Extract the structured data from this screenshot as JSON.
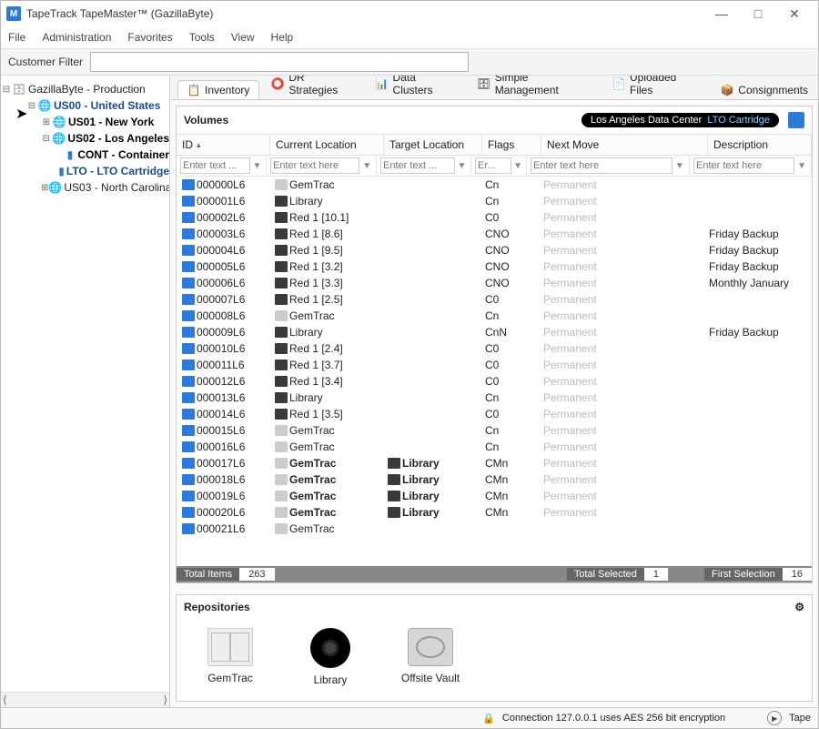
{
  "window": {
    "title": "TapeTrack TapeMaster™ (GazillaByte)",
    "app_icon_letter": "M"
  },
  "menu": {
    "items": [
      "File",
      "Administration",
      "Favorites",
      "Tools",
      "View",
      "Help"
    ]
  },
  "customer_filter": {
    "label": "Customer Filter",
    "value": ""
  },
  "tree": {
    "root": {
      "label": "GazillaByte - Production"
    },
    "nodes": [
      {
        "label": "US00 - United States",
        "depth": 1,
        "style": "bold-blue",
        "expander": "⊟",
        "icon": "globe"
      },
      {
        "label": "US01 - New York",
        "depth": 2,
        "style": "bold-black",
        "expander": "⊞",
        "icon": "globe"
      },
      {
        "label": "US02 - Los Angeles",
        "depth": 2,
        "style": "bold-black",
        "expander": "⊟",
        "icon": "globe"
      },
      {
        "label": "CONT - Container",
        "depth": 3,
        "style": "bold-black",
        "expander": "",
        "icon": "blue-card"
      },
      {
        "label": "LTO - LTO Cartridge",
        "depth": 3,
        "style": "bold-blue",
        "expander": "",
        "icon": "blue-card"
      },
      {
        "label": "US03 - North Carolina",
        "depth": 2,
        "style": "",
        "expander": "⊞",
        "icon": "globe"
      }
    ]
  },
  "tabs": [
    {
      "label": "Inventory",
      "icon": "📋",
      "active": true
    },
    {
      "label": "DR Strategies",
      "icon": "⭕",
      "active": false
    },
    {
      "label": "Data Clusters",
      "icon": "📊",
      "active": false
    },
    {
      "label": "Simple Management",
      "icon": "🗄",
      "active": false
    },
    {
      "label": "Uploaded Files",
      "icon": "📄",
      "active": false
    },
    {
      "label": "Consignments",
      "icon": "📦",
      "active": false
    }
  ],
  "panel": {
    "title": "Volumes",
    "badge_location": "Los Angeles Data Center",
    "badge_media": "LTO Cartridge"
  },
  "columns": {
    "id": "ID",
    "cur": "Current Location",
    "tgt": "Target Location",
    "flags": "Flags",
    "next": "Next Move",
    "desc": "Description"
  },
  "filters": {
    "id": "Enter text ...",
    "cur": "Enter text here",
    "tgt": "Enter text ...",
    "flags": "Er...",
    "next": "Enter text here",
    "desc": "Enter text here"
  },
  "rows": [
    {
      "id": "000000L6",
      "cur_icon": "grey",
      "cur": "GemTrac",
      "tgt_icon": "",
      "tgt": "",
      "flags": "Cn",
      "next": "Permanent",
      "desc": ""
    },
    {
      "id": "000001L6",
      "cur_icon": "dark",
      "cur": "Library",
      "tgt_icon": "",
      "tgt": "",
      "flags": "Cn",
      "next": "Permanent",
      "desc": ""
    },
    {
      "id": "000002L6",
      "cur_icon": "dark",
      "cur": "Red 1 [10.1]",
      "tgt_icon": "",
      "tgt": "",
      "flags": "C0",
      "next": "Permanent",
      "desc": ""
    },
    {
      "id": "000003L6",
      "cur_icon": "dark",
      "cur": "Red 1 [8.6]",
      "tgt_icon": "",
      "tgt": "",
      "flags": "CNO",
      "next": "Permanent",
      "desc": "Friday Backup"
    },
    {
      "id": "000004L6",
      "cur_icon": "dark",
      "cur": "Red 1 [9.5]",
      "tgt_icon": "",
      "tgt": "",
      "flags": "CNO",
      "next": "Permanent",
      "desc": "Friday Backup"
    },
    {
      "id": "000005L6",
      "cur_icon": "dark",
      "cur": "Red 1 [3.2]",
      "tgt_icon": "",
      "tgt": "",
      "flags": "CNO",
      "next": "Permanent",
      "desc": "Friday Backup"
    },
    {
      "id": "000006L6",
      "cur_icon": "dark",
      "cur": "Red 1 [3.3]",
      "tgt_icon": "",
      "tgt": "",
      "flags": "CNO",
      "next": "Permanent",
      "desc": "Monthly January"
    },
    {
      "id": "000007L6",
      "cur_icon": "dark",
      "cur": "Red 1 [2.5]",
      "tgt_icon": "",
      "tgt": "",
      "flags": "C0",
      "next": "Permanent",
      "desc": ""
    },
    {
      "id": "000008L6",
      "cur_icon": "grey",
      "cur": "GemTrac",
      "tgt_icon": "",
      "tgt": "",
      "flags": "Cn",
      "next": "Permanent",
      "desc": ""
    },
    {
      "id": "000009L6",
      "cur_icon": "dark",
      "cur": "Library",
      "tgt_icon": "",
      "tgt": "",
      "flags": "CnN",
      "next": "Permanent",
      "desc": "Friday Backup"
    },
    {
      "id": "000010L6",
      "cur_icon": "dark",
      "cur": "Red 1 [2.4]",
      "tgt_icon": "",
      "tgt": "",
      "flags": "C0",
      "next": "Permanent",
      "desc": ""
    },
    {
      "id": "000011L6",
      "cur_icon": "dark",
      "cur": "Red 1 [3.7]",
      "tgt_icon": "",
      "tgt": "",
      "flags": "C0",
      "next": "Permanent",
      "desc": ""
    },
    {
      "id": "000012L6",
      "cur_icon": "dark",
      "cur": "Red 1 [3.4]",
      "tgt_icon": "",
      "tgt": "",
      "flags": "C0",
      "next": "Permanent",
      "desc": ""
    },
    {
      "id": "000013L6",
      "cur_icon": "dark",
      "cur": "Library",
      "tgt_icon": "",
      "tgt": "",
      "flags": "Cn",
      "next": "Permanent",
      "desc": ""
    },
    {
      "id": "000014L6",
      "cur_icon": "dark",
      "cur": "Red 1 [3.5]",
      "tgt_icon": "",
      "tgt": "",
      "flags": "C0",
      "next": "Permanent",
      "desc": ""
    },
    {
      "id": "000015L6",
      "cur_icon": "grey",
      "cur": "GemTrac",
      "tgt_icon": "",
      "tgt": "",
      "flags": "Cn",
      "next": "Permanent",
      "desc": ""
    },
    {
      "id": "000016L6",
      "cur_icon": "grey",
      "cur": "GemTrac",
      "tgt_icon": "",
      "tgt": "",
      "flags": "Cn",
      "next": "Permanent",
      "desc": ""
    },
    {
      "id": "000017L6",
      "cur_icon": "grey",
      "cur": "GemTrac",
      "cur_bold": true,
      "tgt_icon": "dark",
      "tgt": "Library",
      "tgt_bold": true,
      "flags": "CMn",
      "next": "Permanent",
      "desc": ""
    },
    {
      "id": "000018L6",
      "cur_icon": "grey",
      "cur": "GemTrac",
      "cur_bold": true,
      "tgt_icon": "dark",
      "tgt": "Library",
      "tgt_bold": true,
      "flags": "CMn",
      "next": "Permanent",
      "desc": ""
    },
    {
      "id": "000019L6",
      "cur_icon": "grey",
      "cur": "GemTrac",
      "cur_bold": true,
      "tgt_icon": "dark",
      "tgt": "Library",
      "tgt_bold": true,
      "flags": "CMn",
      "next": "Permanent",
      "desc": ""
    },
    {
      "id": "000020L6",
      "cur_icon": "grey",
      "cur": "GemTrac",
      "cur_bold": true,
      "tgt_icon": "dark",
      "tgt": "Library",
      "tgt_bold": true,
      "flags": "CMn",
      "next": "Permanent",
      "desc": ""
    },
    {
      "id": "000021L6",
      "cur_icon": "grey",
      "cur": "GemTrac",
      "tgt_icon": "",
      "tgt": "",
      "flags": "",
      "next": "",
      "desc": ""
    }
  ],
  "status": {
    "total_items_label": "Total Items",
    "total_items": "263",
    "total_selected_label": "Total Selected",
    "total_selected": "1",
    "first_selection_label": "First Selection",
    "first_selection": "16"
  },
  "repos": {
    "title": "Repositories",
    "items": [
      "GemTrac",
      "Library",
      "Offsite Vault"
    ]
  },
  "footer": {
    "connection": "Connection 127.0.0.1 uses AES 256 bit encryption",
    "tape": "Tape"
  }
}
